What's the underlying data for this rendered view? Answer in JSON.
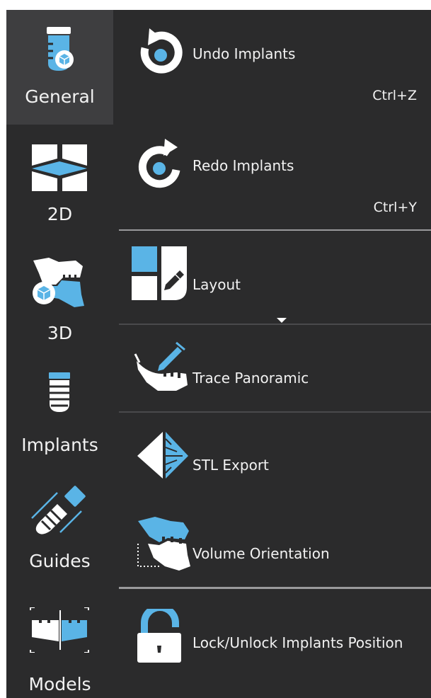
{
  "colors": {
    "background": "#2b2b2c",
    "active": "#3e3e40",
    "accent_blue": "#5ab4e6",
    "icon_white": "#ffffff"
  },
  "nav": {
    "items": [
      {
        "label": "General",
        "icon": "implant-cube-icon",
        "active": true
      },
      {
        "label": "2D",
        "icon": "2d-panels-icon"
      },
      {
        "label": "3D",
        "icon": "3d-jaw-cube-icon"
      },
      {
        "label": "Implants",
        "icon": "implant-icon"
      },
      {
        "label": "Guides",
        "icon": "guide-drill-icon"
      },
      {
        "label": "Models",
        "icon": "model-split-icon"
      }
    ]
  },
  "menu": {
    "undo": {
      "label": "Undo Implants",
      "shortcut": "Ctrl+Z",
      "icon": "undo-icon"
    },
    "redo": {
      "label": "Redo Implants",
      "shortcut": "Ctrl+Y",
      "icon": "redo-icon"
    },
    "layout": {
      "label": "Layout",
      "icon": "layout-edit-icon",
      "dropdown_icon": "caret-down-icon"
    },
    "trace": {
      "label": "Trace Panoramic",
      "icon": "trace-panoramic-icon"
    },
    "stl": {
      "label": "STL Export",
      "icon": "stl-export-icon"
    },
    "volume": {
      "label": "Volume Orientation",
      "icon": "volume-orientation-icon"
    },
    "lock": {
      "label": "Lock/Unlock Implants Position",
      "icon": "unlock-icon"
    }
  }
}
